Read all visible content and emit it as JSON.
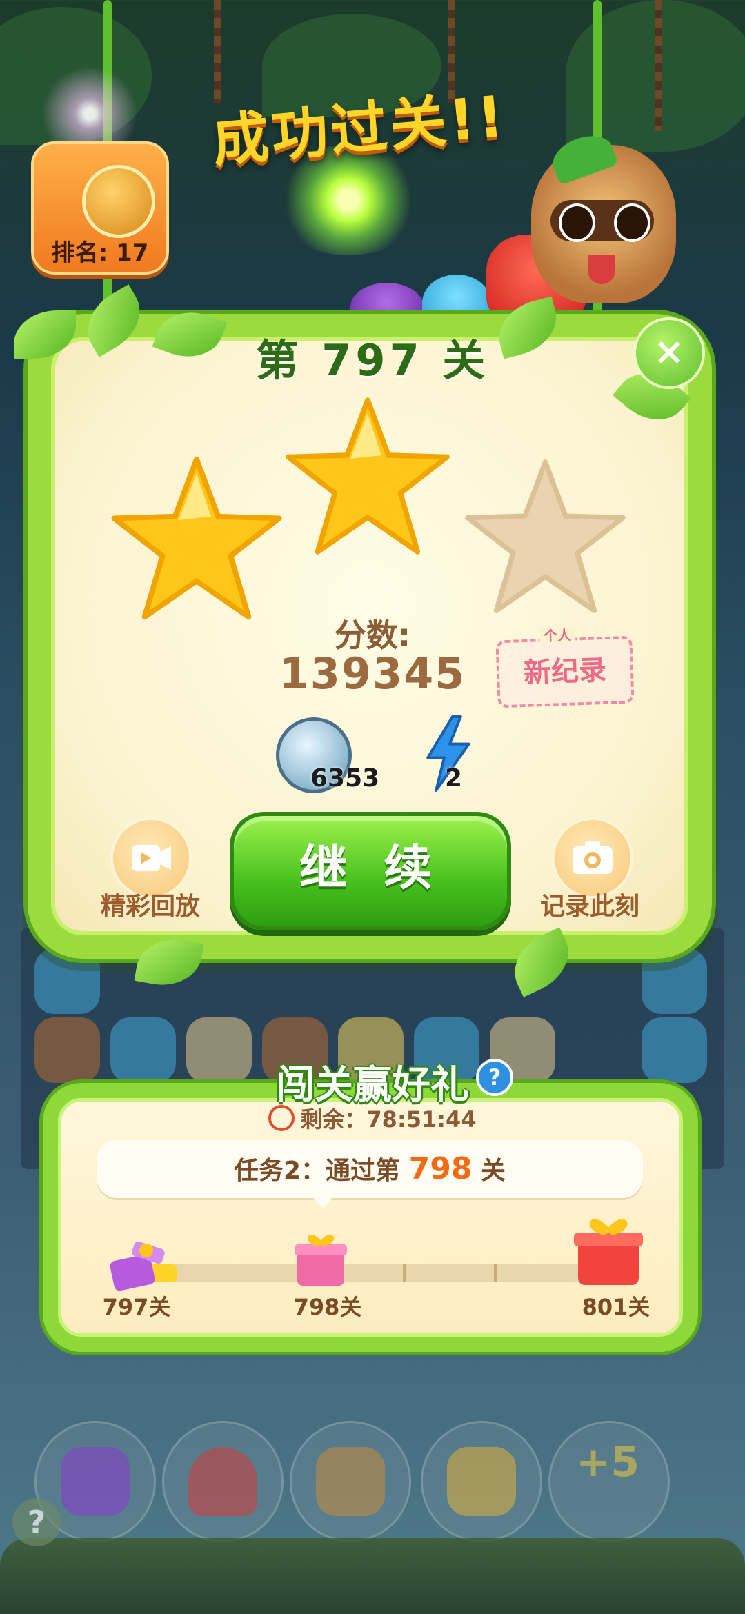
{
  "header": {
    "celebration_title": "成功过关!!",
    "rank_label": "排名: 17"
  },
  "result": {
    "level_title": "第 797 关",
    "stars_earned": 2,
    "stars_total": 3,
    "score_label": "分数:",
    "score_value": "139345",
    "record_small": "个人",
    "record_label": "新纪录",
    "coins": "6353",
    "energy": "2",
    "replay_label": "精彩回放",
    "continue_label": "继 续",
    "snapshot_label": "记录此刻",
    "close_glyph": "×"
  },
  "event": {
    "title": "闯关赢好礼",
    "help_glyph": "?",
    "timer_label": "剩余：78:51:44",
    "task_prefix": "任务2：通过第",
    "task_level": "798",
    "task_suffix": "关",
    "progress_fraction": 0.1,
    "milestones": [
      "797关",
      "798关",
      "801关"
    ]
  },
  "boosters": {
    "plus_label": "+5",
    "help_glyph": "?"
  },
  "colors": {
    "frame_green": "#9bdb3d",
    "star_gold": "#ffc61a",
    "star_empty": "#e9d3b0",
    "continue_green": "#46c01d",
    "record_pink": "#ee6a87",
    "highlight_orange": "#f36a12"
  }
}
